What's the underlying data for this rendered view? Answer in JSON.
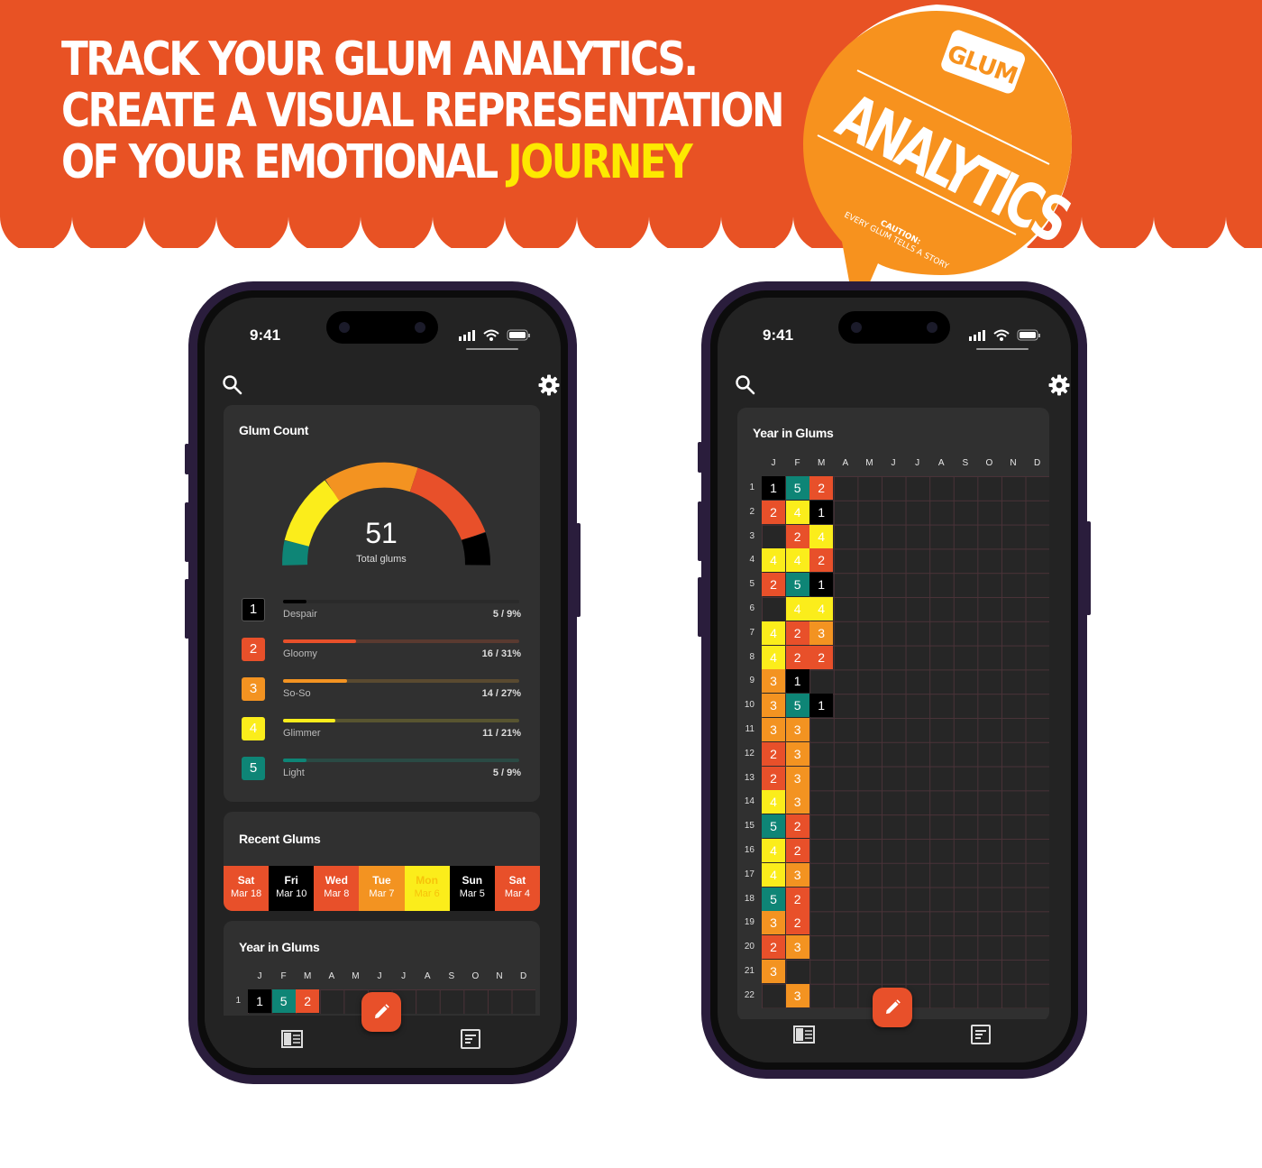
{
  "headline": {
    "line1": "TRACK YOUR GLUM ANALYTICS.",
    "line2": "CREATE A VISUAL REPRESENTATION",
    "line3_prefix": "OF YOUR EMOTIONAL ",
    "line3_highlight": "JOURNEY"
  },
  "badge": {
    "brand": "GLUM",
    "title": "ANALYTICS",
    "caution": "CAUTION:",
    "tagline": "EVERY GLUM TELLS A STORY"
  },
  "colors": {
    "banner": "#e85224",
    "highlight": "#fde900",
    "badge": "#f7921e",
    "mood1": "#000000",
    "mood2": "#e8502a",
    "mood3": "#f39321",
    "mood4": "#fbed1b",
    "mood5": "#0e8576"
  },
  "status_bar": {
    "time": "9:41"
  },
  "icons": {
    "search": "search-icon",
    "settings": "gear-icon",
    "fab": "pencil-icon",
    "nav_left": "journal-icon",
    "nav_right": "notes-icon"
  },
  "glum_count": {
    "title": "Glum Count",
    "total": "51",
    "total_label": "Total glums",
    "moods": [
      {
        "level": "1",
        "name": "Despair",
        "value": "5 / 9%",
        "pct": 0.1
      },
      {
        "level": "2",
        "name": "Gloomy",
        "value": "16 / 31%",
        "pct": 0.31
      },
      {
        "level": "3",
        "name": "So-So",
        "value": "14 / 27%",
        "pct": 0.27
      },
      {
        "level": "4",
        "name": "Glimmer",
        "value": "11 / 21%",
        "pct": 0.22
      },
      {
        "level": "5",
        "name": "Light",
        "value": "5 / 9%",
        "pct": 0.1
      }
    ]
  },
  "recent": {
    "title": "Recent Glums",
    "days": [
      {
        "day": "Sat",
        "date": "Mar 18",
        "level": 2
      },
      {
        "day": "Fri",
        "date": "Mar 10",
        "level": 1
      },
      {
        "day": "Wed",
        "date": "Mar 8",
        "level": 2
      },
      {
        "day": "Tue",
        "date": "Mar 7",
        "level": 3
      },
      {
        "day": "Mon",
        "date": "Mar 6",
        "level": 4
      },
      {
        "day": "Sun",
        "date": "Mar 5",
        "level": 1
      },
      {
        "day": "Sat",
        "date": "Mar 4",
        "level": 2
      }
    ]
  },
  "year": {
    "title": "Year in Glums",
    "months": [
      "J",
      "F",
      "M",
      "A",
      "M",
      "J",
      "J",
      "A",
      "S",
      "O",
      "N",
      "D"
    ],
    "days": [
      "1",
      "2",
      "3",
      "4",
      "5",
      "6",
      "7",
      "8",
      "9",
      "10",
      "11",
      "12",
      "13",
      "14",
      "15",
      "16",
      "17",
      "18",
      "19",
      "20",
      "21",
      "22"
    ],
    "values": [
      [
        1,
        5,
        2
      ],
      [
        2,
        4,
        1
      ],
      [
        0,
        2,
        4
      ],
      [
        4,
        4,
        2
      ],
      [
        2,
        5,
        1
      ],
      [
        0,
        4,
        4
      ],
      [
        4,
        2,
        3
      ],
      [
        4,
        2,
        2
      ],
      [
        3,
        1,
        0
      ],
      [
        3,
        5,
        1
      ],
      [
        3,
        3,
        0
      ],
      [
        2,
        3,
        0
      ],
      [
        2,
        3,
        0
      ],
      [
        4,
        3,
        0
      ],
      [
        5,
        2,
        0
      ],
      [
        4,
        2,
        0
      ],
      [
        4,
        3,
        0
      ],
      [
        5,
        2,
        0
      ],
      [
        3,
        2,
        0
      ],
      [
        2,
        3,
        0
      ],
      [
        3,
        0,
        0
      ],
      [
        0,
        3,
        0
      ]
    ]
  }
}
